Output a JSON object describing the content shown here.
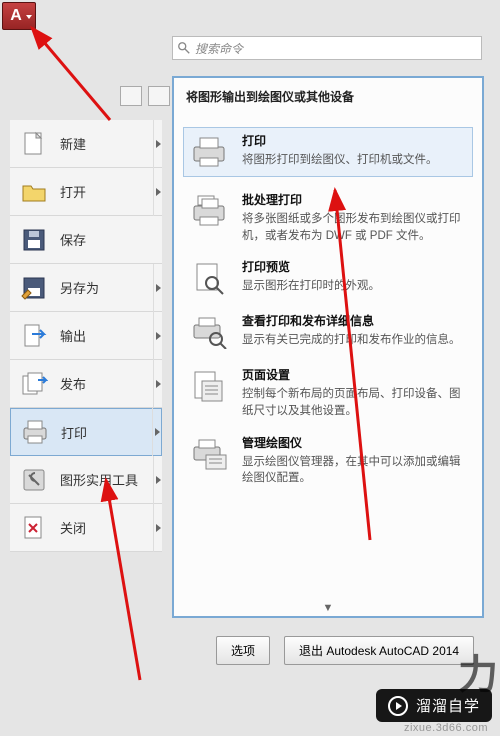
{
  "app_icon_letter": "A",
  "search_placeholder": "搜索命令",
  "panel": {
    "title": "将图形输出到绘图仪或其他设备",
    "options": [
      {
        "title": "打印",
        "desc": "将图形打印到绘图仪、打印机或文件。"
      },
      {
        "title": "批处理打印",
        "desc": "将多张图纸或多个图形发布到绘图仪或打印机，或者发布为 DWF 或 PDF 文件。"
      },
      {
        "title": "打印预览",
        "desc": "显示图形在打印时的外观。"
      },
      {
        "title": "查看打印和发布详细信息",
        "desc": "显示有关已完成的打印和发布作业的信息。"
      },
      {
        "title": "页面设置",
        "desc": "控制每个新布局的页面布局、打印设备、图纸尺寸以及其他设置。"
      },
      {
        "title": "管理绘图仪",
        "desc": "显示绘图仪管理器，在其中可以添加或编辑绘图仪配置。"
      }
    ],
    "down_arrow": "▼"
  },
  "sidebar": {
    "items": [
      {
        "label": "新建",
        "has_arrow": true
      },
      {
        "label": "打开",
        "has_arrow": true
      },
      {
        "label": "保存",
        "has_arrow": false
      },
      {
        "label": "另存为",
        "has_arrow": true
      },
      {
        "label": "输出",
        "has_arrow": true
      },
      {
        "label": "发布",
        "has_arrow": true
      },
      {
        "label": "打印",
        "has_arrow": true,
        "selected": true
      },
      {
        "label": "图形实用工具",
        "has_arrow": true
      },
      {
        "label": "关闭",
        "has_arrow": true
      }
    ]
  },
  "bottom": {
    "options_btn": "选项",
    "exit_btn": "退出 Autodesk AutoCAD 2014"
  },
  "watermark": {
    "label": "溜溜自学",
    "sub": "zixue.3d66.com"
  }
}
